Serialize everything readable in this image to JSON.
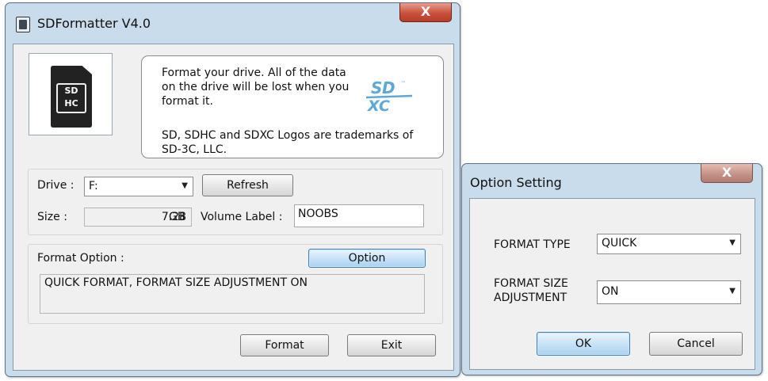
{
  "main_window": {
    "title": "SDFormatter V4.0",
    "close_label": "X",
    "card_logo": "SD\nHC",
    "info_text": "Format your drive. All of the data on the drive will be lost when you format it.",
    "trademark_text": "SD, SDHC and SDXC Logos are trademarks of SD-3C, LLC.",
    "logo_text": "SD XC",
    "drive_label": "Drive :",
    "drive_value": "F:",
    "refresh_label": "Refresh",
    "size_label": "Size  :",
    "size_value": "7.28",
    "size_unit": "GB",
    "volume_label": "Volume Label  :",
    "volume_value": "NOOBS",
    "format_option_label": "Format Option :",
    "option_button": "Option",
    "format_description": "QUICK FORMAT, FORMAT SIZE ADJUSTMENT ON",
    "format_button": "Format",
    "exit_button": "Exit"
  },
  "option_window": {
    "title": "Option Setting",
    "close_label": "X",
    "format_type_label": "FORMAT TYPE",
    "format_type_value": "QUICK",
    "size_adjust_label_1": "FORMAT SIZE",
    "size_adjust_label_2": "ADJUSTMENT",
    "size_adjust_value": "ON",
    "ok_button": "OK",
    "cancel_button": "Cancel"
  }
}
